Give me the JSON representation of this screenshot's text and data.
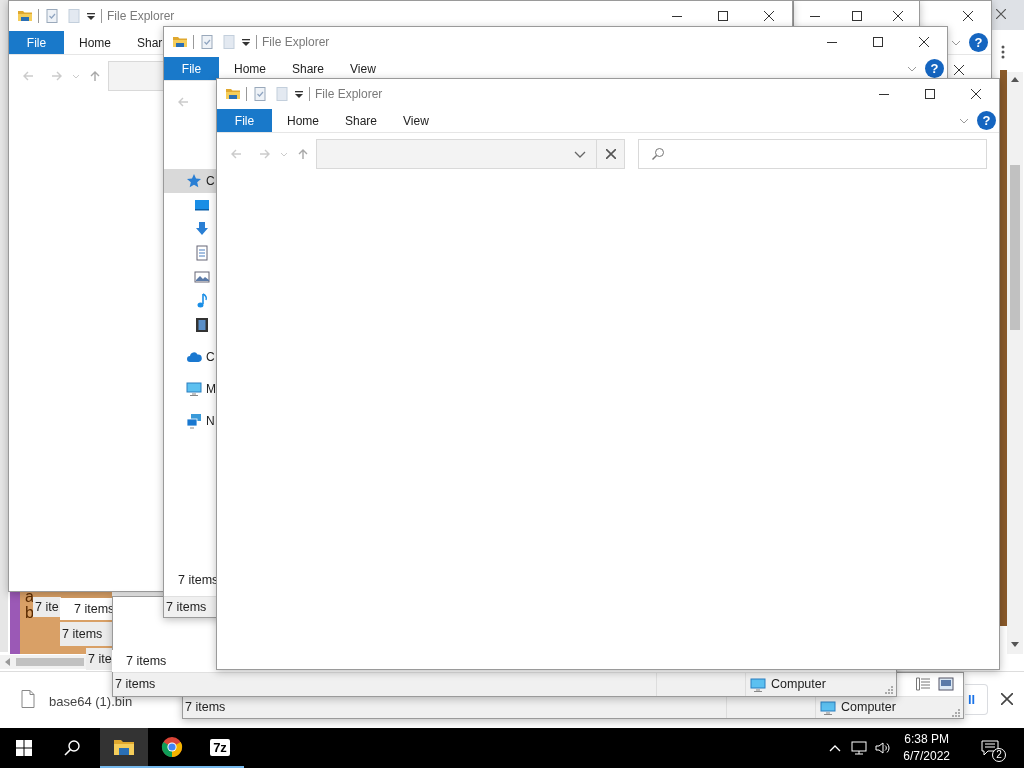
{
  "browser": {
    "page_text": [
      "a",
      "b"
    ],
    "download": {
      "file_name": "base64 (1).bin",
      "button_label": "ll"
    }
  },
  "background_window": {
    "help": "?"
  },
  "windows": [
    {
      "title": "File Explorer",
      "tabs": [
        {
          "label": "File",
          "selected": true
        },
        {
          "label": "Home",
          "selected": false
        },
        {
          "label": "Shar",
          "selected": false
        }
      ]
    },
    {
      "title": "File Explorer",
      "tabs": [
        {
          "label": "File",
          "selected": true
        },
        {
          "label": "Home",
          "selected": false
        },
        {
          "label": "Share",
          "selected": false
        },
        {
          "label": "View",
          "selected": false
        }
      ],
      "help": "?",
      "nav_pane": [
        {
          "label": "C",
          "selected": true
        },
        {
          "label": "C",
          "selected": false
        },
        {
          "label": "M",
          "selected": false
        },
        {
          "label": "N",
          "selected": false
        }
      ],
      "footer_text": "7 items",
      "status": "7 items"
    },
    {
      "title": "File Explorer",
      "tabs": [
        {
          "label": "File",
          "selected": true
        },
        {
          "label": "Home",
          "selected": false
        },
        {
          "label": "Share",
          "selected": false
        },
        {
          "label": "View",
          "selected": false
        }
      ],
      "help": "?"
    }
  ],
  "stacked_windows": [
    {
      "status": "7 ite"
    },
    {
      "status": "7 items"
    },
    {
      "status": "7 items"
    },
    {
      "status": "7 ite"
    },
    {
      "status": "7 items"
    },
    {
      "status": "7 items",
      "location": "Computer"
    },
    {
      "status": "7 items",
      "location": "Computer"
    }
  ],
  "taskbar": {
    "app_label": "7z",
    "time": "6:38 PM",
    "date": "6/7/2022",
    "notifications": "2"
  }
}
